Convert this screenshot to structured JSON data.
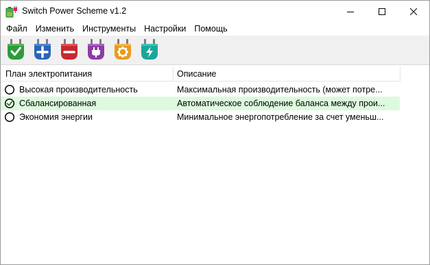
{
  "window": {
    "title": "Switch Power Scheme v1.2"
  },
  "menu": [
    {
      "label": "Файл"
    },
    {
      "label": "Изменить"
    },
    {
      "label": "Инструменты"
    },
    {
      "label": "Настройки"
    },
    {
      "label": "Помощь"
    }
  ],
  "toolbar": [
    {
      "icon": "plug-check-icon",
      "color": "#2f9a3c"
    },
    {
      "icon": "plug-add-icon",
      "color": "#2a63b8"
    },
    {
      "icon": "plug-remove-icon",
      "color": "#c8282e"
    },
    {
      "icon": "plug-plug-icon",
      "color": "#8e3aa6"
    },
    {
      "icon": "plug-gear-icon",
      "color": "#e79a1d"
    },
    {
      "icon": "plug-lightning-icon",
      "color": "#1aa79a"
    }
  ],
  "list": {
    "columns": [
      "План электропитания",
      "Описание"
    ],
    "rows": [
      {
        "name": "Высокая производительность",
        "description": "Максимальная производительность (может потре...",
        "selected": false
      },
      {
        "name": "Сбалансированная",
        "description": "Автоматическое соблюдение баланса между прои...",
        "selected": true
      },
      {
        "name": "Экономия энергии",
        "description": "Минимальное энергопотребление за счет уменьш...",
        "selected": false
      }
    ]
  },
  "colors": {
    "selected_row": "#ddfadd",
    "toolbar_bg": "#f0f0f0"
  }
}
